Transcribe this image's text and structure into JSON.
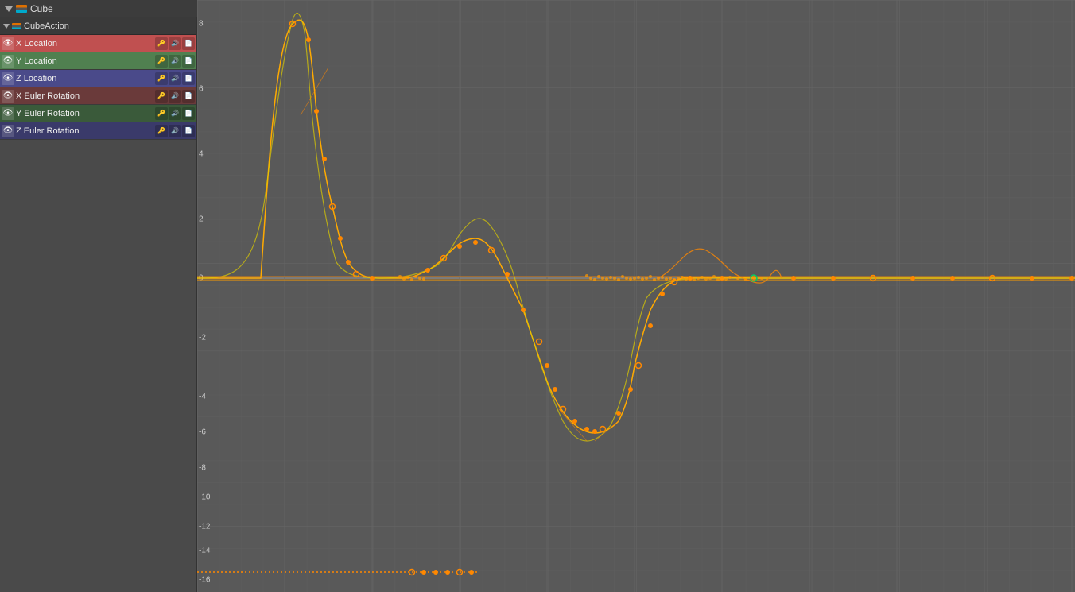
{
  "titleBar": {
    "title": "Cube"
  },
  "sidebar": {
    "actionRow": {
      "label": "CubeAction"
    },
    "channels": [
      {
        "id": "x-loc",
        "label": "X Location",
        "colorClass": "x-loc",
        "eyeColor": "#cc4444"
      },
      {
        "id": "y-loc",
        "label": "Y Location",
        "colorClass": "y-loc",
        "eyeColor": "#44aa44"
      },
      {
        "id": "z-loc",
        "label": "Z Location",
        "colorClass": "z-loc",
        "eyeColor": "#4466cc"
      },
      {
        "id": "x-euler",
        "label": "X Euler Rotation",
        "colorClass": "x-euler",
        "eyeColor": "#cc4444"
      },
      {
        "id": "y-euler",
        "label": "Y Euler Rotation",
        "colorClass": "y-euler",
        "eyeColor": "#44aa44"
      },
      {
        "id": "z-euler",
        "label": "Z Euler Rotation",
        "colorClass": "z-euler",
        "eyeColor": "#4466cc"
      }
    ]
  },
  "graph": {
    "yAxisLabels": [
      {
        "value": "8",
        "pct": 4
      },
      {
        "value": "6",
        "pct": 15
      },
      {
        "value": "4",
        "pct": 26
      },
      {
        "value": "2",
        "pct": 37
      },
      {
        "value": "0",
        "pct": 47
      },
      {
        "value": "-2",
        "pct": 57
      },
      {
        "value": "-4",
        "pct": 67
      },
      {
        "value": "-6",
        "pct": 73
      },
      {
        "value": "-8",
        "pct": 79
      },
      {
        "value": "-10",
        "pct": 84
      },
      {
        "value": "-12",
        "pct": 89
      },
      {
        "value": "-14",
        "pct": 93
      },
      {
        "value": "-16",
        "pct": 98
      }
    ]
  }
}
